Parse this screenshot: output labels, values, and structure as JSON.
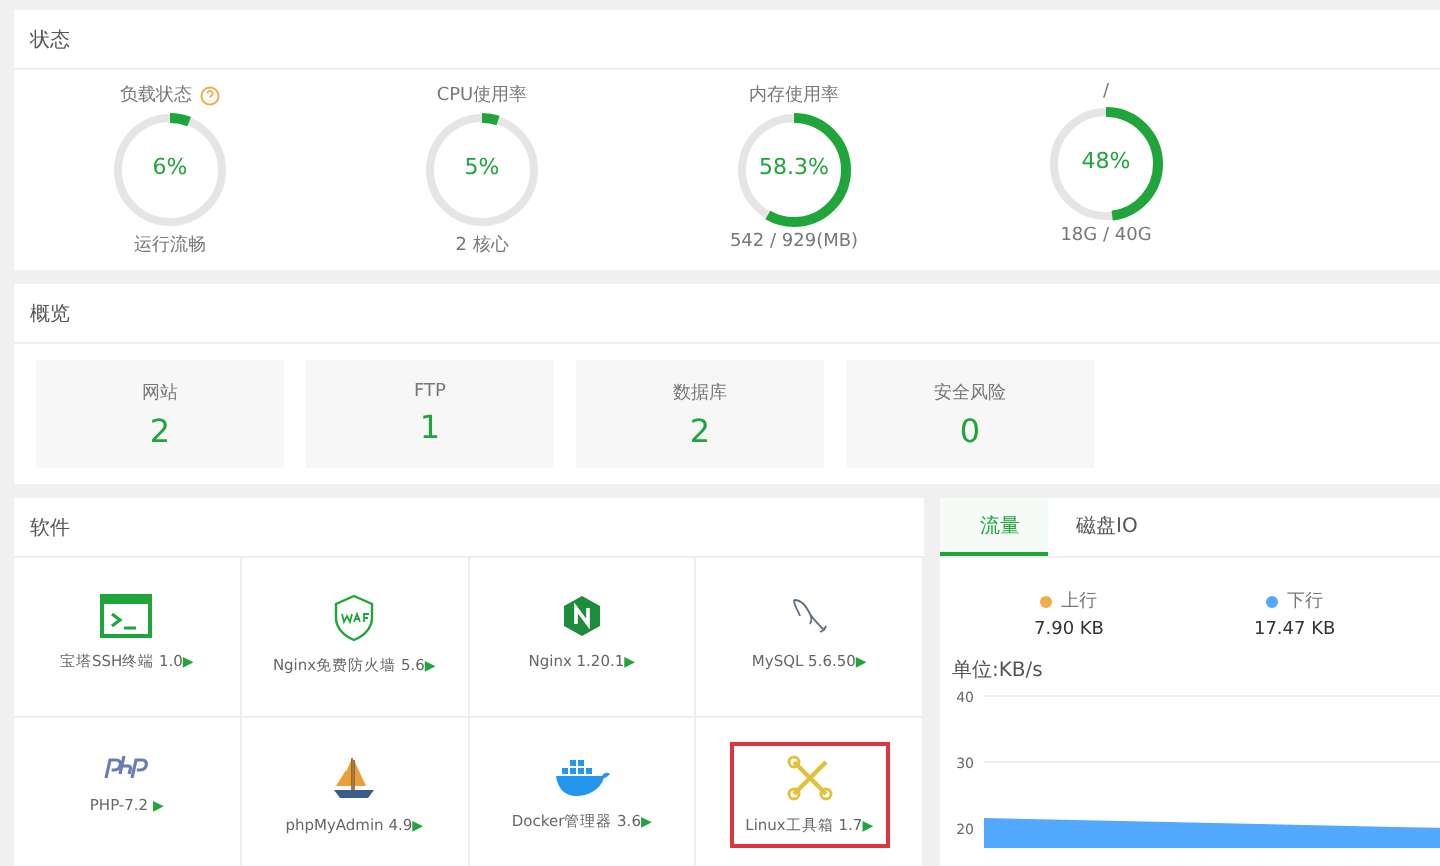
{
  "status": {
    "title": "状态",
    "gauges": [
      {
        "label": "负载状态",
        "help": true,
        "value": "6%",
        "level": 0.06,
        "caption": "运行流畅"
      },
      {
        "label": "CPU使用率",
        "help": false,
        "value": "5%",
        "level": 0.05,
        "caption": "2 核心"
      },
      {
        "label": "内存使用率",
        "help": false,
        "value": "58.3%",
        "level": 0.583,
        "caption": "542 / 929(MB)"
      },
      {
        "label": "/",
        "help": false,
        "value": "48%",
        "level": 0.48,
        "caption": "18G / 40G"
      }
    ]
  },
  "overview": {
    "title": "概览",
    "items": [
      {
        "label": "网站",
        "value": "2"
      },
      {
        "label": "FTP",
        "value": "1"
      },
      {
        "label": "数据库",
        "value": "2"
      },
      {
        "label": "安全风险",
        "value": "0"
      }
    ]
  },
  "software": {
    "title": "软件",
    "items": [
      {
        "kind": "terminal",
        "name": "宝塔SSH终端 1.0",
        "arrow": "▶",
        "highlighted": false
      },
      {
        "kind": "waf",
        "name": "Nginx免费防火墙 5.6",
        "arrow": "▶",
        "highlighted": false
      },
      {
        "kind": "nginx",
        "name": "Nginx 1.20.1",
        "arrow": "▶",
        "highlighted": false
      },
      {
        "kind": "mysql",
        "name": "MySQL 5.6.50",
        "arrow": "▶",
        "highlighted": false
      },
      {
        "kind": "php",
        "name": "PHP-7.2 ",
        "arrow": "▶",
        "highlighted": false
      },
      {
        "kind": "ship",
        "name": "phpMyAdmin 4.9",
        "arrow": "▶",
        "highlighted": false
      },
      {
        "kind": "docker",
        "name": "Docker管理器 3.6",
        "arrow": "▶",
        "highlighted": false
      },
      {
        "kind": "tools",
        "name": "Linux工具箱 1.7",
        "arrow": "▶",
        "highlighted": true
      }
    ]
  },
  "traffic": {
    "tabs": [
      {
        "label": "流量",
        "selected": true
      },
      {
        "label": "磁盘IO",
        "selected": false
      }
    ],
    "stats": [
      {
        "label": "上行",
        "value": "7.90 KB",
        "color": "#f0ad4e"
      },
      {
        "label": "下行",
        "value": "17.47 KB",
        "color": "#52a9ff"
      }
    ],
    "chart": {
      "unit": "单位:KB/s",
      "ticks": [
        "40",
        "30",
        "20"
      ]
    }
  }
}
